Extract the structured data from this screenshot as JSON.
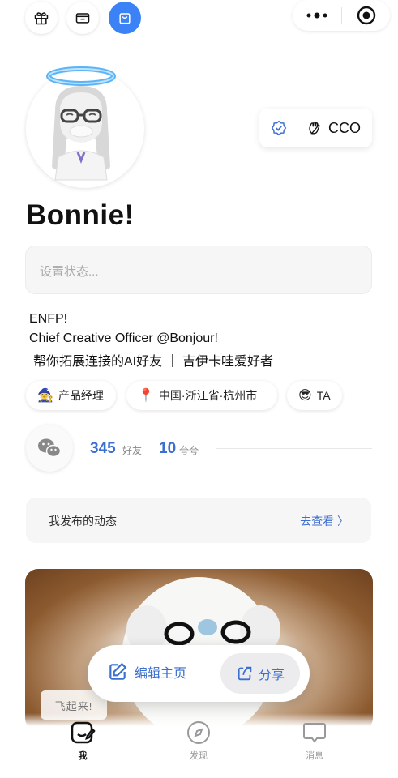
{
  "header": {
    "left_icons": [
      "gift-icon",
      "wallet-icon",
      "bag-icon"
    ],
    "active_icon": "bag-icon",
    "capsule": [
      "more-icon",
      "close-target-icon"
    ]
  },
  "profile": {
    "avatar": "avatar",
    "role_badge": {
      "verified_icon": "verified-badge-icon",
      "hand_icon": "wave-hand-icon",
      "label": "CCO"
    },
    "name": "Bonnie!",
    "status_placeholder": "设置状态...",
    "bio": [
      "ENFP!",
      "Chief Creative Officer @Bonjour!",
      "帮你拓展连接的AI好友 ｜ 吉伊卡哇爱好者"
    ]
  },
  "tags": [
    {
      "emoji": "🧙",
      "label": "产品经理"
    },
    {
      "emoji": "📍",
      "label": "中国·浙江省·杭州市"
    },
    {
      "emoji": "😎",
      "label": "TA"
    }
  ],
  "stats": {
    "friends_count": "345",
    "friends_label": "好友",
    "praise_count": "10",
    "praise_label": "夸夸"
  },
  "posts": {
    "title": "我发布的动态",
    "link": "去查看 〉"
  },
  "photo": {
    "caption": "飞起来!"
  },
  "actions": {
    "edit": "编辑主页",
    "share": "分享"
  },
  "tabs": [
    {
      "label": "我",
      "icon": "edit-profile-icon",
      "active": true
    },
    {
      "label": "发现",
      "icon": "compass-icon",
      "active": false
    },
    {
      "label": "消息",
      "icon": "message-icon",
      "active": false
    }
  ],
  "colors": {
    "accent": "#3b6fd0",
    "active_icon_bg": "#3b82f6"
  }
}
